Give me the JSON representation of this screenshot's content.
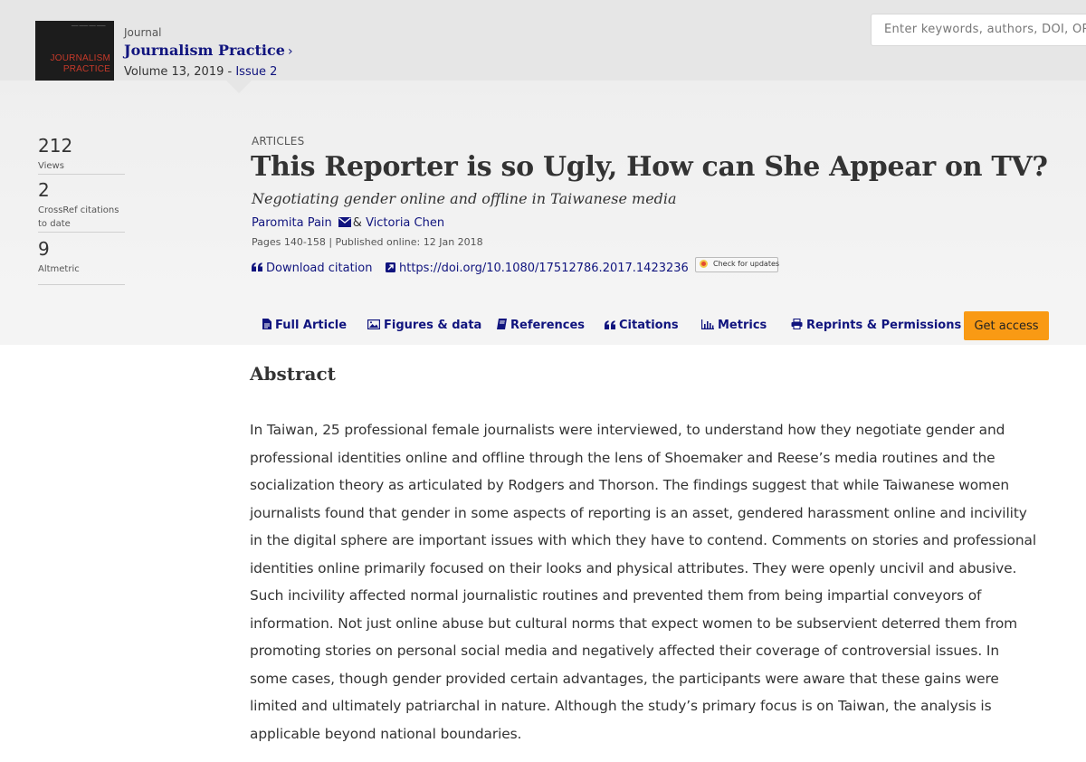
{
  "journal": {
    "label": "Journal",
    "name": "Journalism Practice",
    "chevron": "›",
    "volume_text": "Volume 13, 2019 - ",
    "issue": "Issue 2",
    "cover_title_line1": "JOURNALISM",
    "cover_title_line2": "PRACTICE"
  },
  "search": {
    "placeholder": "Enter keywords, authors, DOI, ORCID etc"
  },
  "metrics": [
    {
      "value": "212",
      "label": "Views"
    },
    {
      "value": "2",
      "label_line1": "CrossRef citations",
      "label_line2": "to date"
    },
    {
      "value": "9",
      "label": "Altmetric"
    }
  ],
  "article": {
    "type": "ARTICLES",
    "title": "This Reporter is so Ugly, How can She Appear on TV?",
    "subtitle": "Negotiating gender online and offline in Taiwanese media",
    "author1": "Paromita Pain",
    "author_sep": "& ",
    "author2": "Victoria Chen",
    "pages": "Pages 140-158 | Published online: 12 Jan 2018",
    "download_citation": "Download citation",
    "doi": "https://doi.org/10.1080/17512786.2017.1423236",
    "check_updates": "Check for updates"
  },
  "tabs": {
    "full_article": "Full Article",
    "figures": "Figures & data",
    "references": "References",
    "citations": "Citations",
    "metrics": "Metrics",
    "reprints": "Reprints & Permissions",
    "get_access": "Get access"
  },
  "abstract": {
    "heading": "Abstract",
    "text": "In Taiwan, 25 professional female journalists were interviewed, to understand how they negotiate gender and professional identities online and offline through the lens of Shoemaker and Reese’s media routines and the socialization theory as articulated by Rodgers and Thorson. The findings suggest that while Taiwanese women journalists found that gender in some aspects of reporting is an asset, gendered harassment online and incivility in the digital sphere are important issues with which they have to contend. Comments on stories and professional identities online primarily focused on their looks and physical attributes. They were openly uncivil and abusive. Such incivility affected normal journalistic routines and prevented them from being impartial conveyors of information. Not just online abuse but cultural norms that expect women to be subservient deterred them from promoting stories on personal social media and negatively affected their coverage of controversial issues. In some cases, though gender provided certain advantages, the participants were aware that these gains were limited and ultimately patriarchal in nature. Although the study’s primary focus is on Taiwan, the analysis is applicable beyond national boundaries."
  },
  "colors": {
    "link": "#10147e",
    "accent_button": "#f99a14",
    "cover_title": "#c63a2a"
  }
}
